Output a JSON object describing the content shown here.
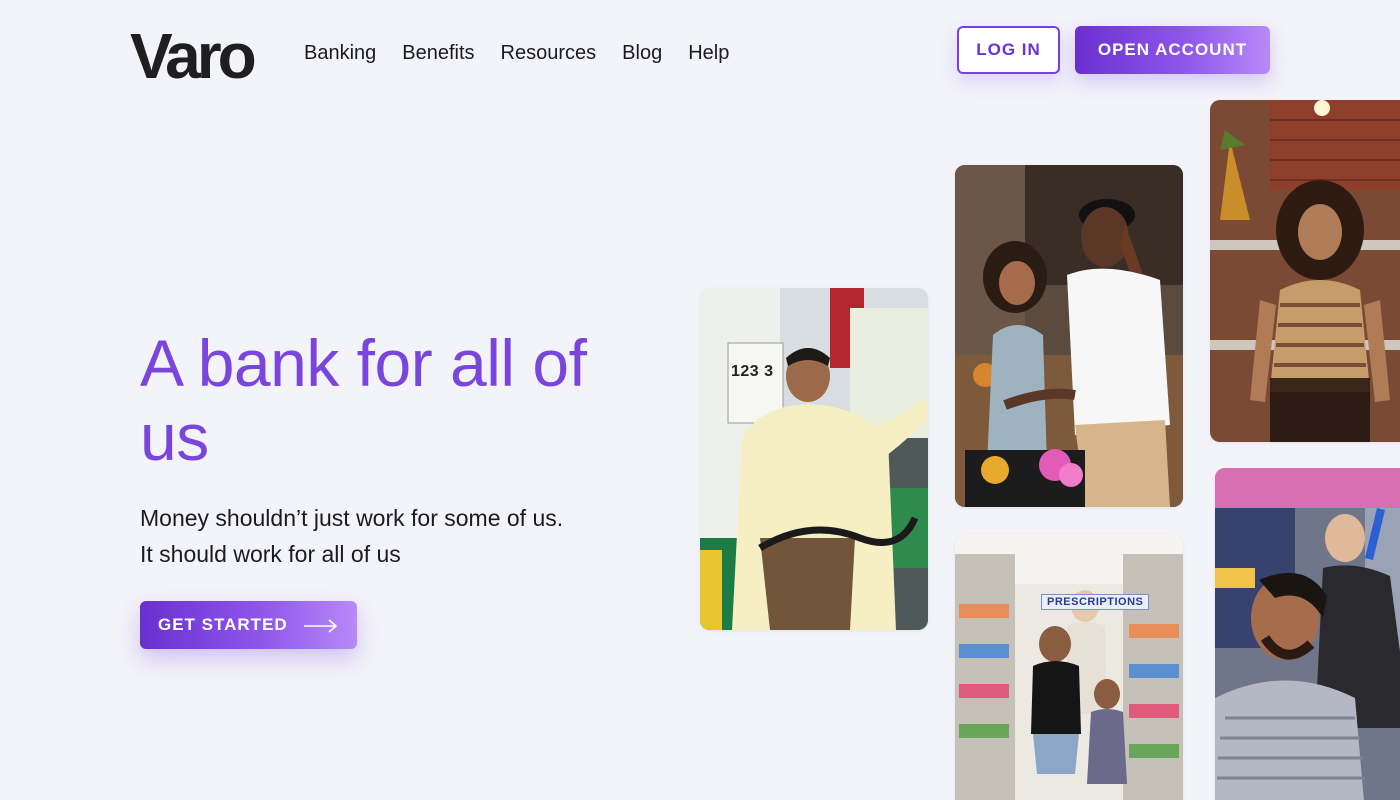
{
  "brand": {
    "name": "Varo",
    "accent": "#7a45dd",
    "accent_dark": "#6b2fd0",
    "background": "#f3f3fa"
  },
  "nav": {
    "items": [
      {
        "label": "Banking"
      },
      {
        "label": "Benefits"
      },
      {
        "label": "Resources"
      },
      {
        "label": "Blog"
      },
      {
        "label": "Help"
      }
    ]
  },
  "header": {
    "login_label": "LOG IN",
    "open_account_label": "OPEN ACCOUNT"
  },
  "hero": {
    "title": "A bank for all of us",
    "subtitle_line1": "Money shouldn’t just work for some of us.",
    "subtitle_line2": "It should work for all of us",
    "cta_label": "GET STARTED",
    "cta_icon": "arrow-right-icon"
  },
  "photos": {
    "gas_station": {
      "sign_digits": "123 3"
    },
    "pharmacy": {
      "sign_text": "PRESCRIPTIONS"
    }
  }
}
